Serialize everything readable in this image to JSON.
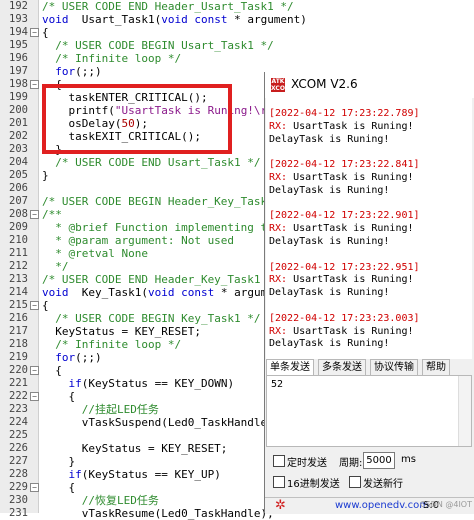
{
  "editor": {
    "lines": [
      {
        "n": "192",
        "fold": "",
        "parts": [
          [
            "cm",
            "/* USER CODE END Header_Usart_Task1 */"
          ]
        ]
      },
      {
        "n": "193",
        "fold": "",
        "parts": [
          [
            "kw",
            "void"
          ],
          [
            "",
            "  Usart_Task1("
          ],
          [
            "kw",
            "void const"
          ],
          [
            "",
            " * argument)"
          ]
        ]
      },
      {
        "n": "194",
        "fold": "box",
        "parts": [
          [
            "",
            "{"
          ]
        ]
      },
      {
        "n": "195",
        "fold": "",
        "parts": [
          [
            "",
            "  "
          ],
          [
            "cm",
            "/* USER CODE BEGIN Usart_Task1 */"
          ]
        ]
      },
      {
        "n": "196",
        "fold": "",
        "parts": [
          [
            "",
            "  "
          ],
          [
            "cm",
            "/* Infinite loop */"
          ]
        ]
      },
      {
        "n": "197",
        "fold": "",
        "parts": [
          [
            "",
            "  "
          ],
          [
            "kw",
            "for"
          ],
          [
            "",
            "(;;)"
          ]
        ]
      },
      {
        "n": "198",
        "fold": "box",
        "parts": [
          [
            "",
            "  {"
          ]
        ]
      },
      {
        "n": "199",
        "fold": "",
        "parts": [
          [
            "",
            "    taskENTER_CRITICAL();"
          ]
        ]
      },
      {
        "n": "200",
        "fold": "",
        "parts": [
          [
            "",
            "    printf("
          ],
          [
            "str",
            "\"UsartTask is Runing!\\r\\"
          ]
        ]
      },
      {
        "n": "201",
        "fold": "",
        "parts": [
          [
            "",
            "    osDelay("
          ],
          [
            "num",
            "50"
          ],
          [
            "",
            ");"
          ]
        ]
      },
      {
        "n": "202",
        "fold": "",
        "parts": [
          [
            "",
            "    taskEXIT_CRITICAL();"
          ]
        ]
      },
      {
        "n": "203",
        "fold": "",
        "parts": [
          [
            "",
            "  }"
          ]
        ]
      },
      {
        "n": "204",
        "fold": "",
        "parts": [
          [
            "",
            "  "
          ],
          [
            "cm",
            "/* USER CODE END Usart_Task1 */"
          ]
        ]
      },
      {
        "n": "205",
        "fold": "",
        "parts": [
          [
            "",
            "}"
          ]
        ]
      },
      {
        "n": "206",
        "fold": "",
        "parts": [
          [
            "",
            ""
          ]
        ]
      },
      {
        "n": "207",
        "fold": "",
        "parts": [
          [
            "cm",
            "/* USER CODE BEGIN Header_Key_Task1 */"
          ]
        ]
      },
      {
        "n": "208",
        "fold": "box",
        "parts": [
          [
            "cm",
            "/**"
          ]
        ]
      },
      {
        "n": "209",
        "fold": "",
        "parts": [
          [
            "cm",
            "  * @brief Function implementing the"
          ]
        ]
      },
      {
        "n": "210",
        "fold": "",
        "parts": [
          [
            "cm",
            "  * @param argument: Not used"
          ]
        ]
      },
      {
        "n": "211",
        "fold": "",
        "parts": [
          [
            "cm",
            "  * @retval None"
          ]
        ]
      },
      {
        "n": "212",
        "fold": "",
        "parts": [
          [
            "cm",
            "  */"
          ]
        ]
      },
      {
        "n": "213",
        "fold": "",
        "parts": [
          [
            "cm",
            "/* USER CODE END Header_Key_Task1 */"
          ]
        ]
      },
      {
        "n": "214",
        "fold": "",
        "parts": [
          [
            "kw",
            "void"
          ],
          [
            "",
            "  Key_Task1("
          ],
          [
            "kw",
            "void const"
          ],
          [
            "",
            " * argumen"
          ]
        ]
      },
      {
        "n": "215",
        "fold": "box",
        "parts": [
          [
            "",
            "{"
          ]
        ]
      },
      {
        "n": "216",
        "fold": "",
        "parts": [
          [
            "",
            "  "
          ],
          [
            "cm",
            "/* USER CODE BEGIN Key_Task1 */"
          ]
        ]
      },
      {
        "n": "217",
        "fold": "",
        "parts": [
          [
            "",
            "  KeyStatus = KEY_RESET;"
          ]
        ]
      },
      {
        "n": "218",
        "fold": "",
        "parts": [
          [
            "",
            "  "
          ],
          [
            "cm",
            "/* Infinite loop */"
          ]
        ]
      },
      {
        "n": "219",
        "fold": "",
        "parts": [
          [
            "",
            "  "
          ],
          [
            "kw",
            "for"
          ],
          [
            "",
            "(;;)"
          ]
        ]
      },
      {
        "n": "220",
        "fold": "box",
        "parts": [
          [
            "",
            "  {"
          ]
        ]
      },
      {
        "n": "221",
        "fold": "",
        "parts": [
          [
            "",
            "    "
          ],
          [
            "kw",
            "if"
          ],
          [
            "",
            "(KeyStatus == KEY_DOWN)"
          ]
        ]
      },
      {
        "n": "222",
        "fold": "box",
        "parts": [
          [
            "",
            "    {"
          ]
        ]
      },
      {
        "n": "223",
        "fold": "",
        "parts": [
          [
            "",
            "      "
          ],
          [
            "cm",
            "//挂起LED任务"
          ]
        ]
      },
      {
        "n": "224",
        "fold": "",
        "parts": [
          [
            "",
            "      vTaskSuspend(Led0_TaskHandle)"
          ]
        ]
      },
      {
        "n": "225",
        "fold": "",
        "parts": [
          [
            "",
            ""
          ]
        ]
      },
      {
        "n": "226",
        "fold": "",
        "parts": [
          [
            "",
            "      KeyStatus = KEY_RESET;"
          ]
        ]
      },
      {
        "n": "227",
        "fold": "",
        "parts": [
          [
            "",
            "    }"
          ]
        ]
      },
      {
        "n": "228",
        "fold": "",
        "parts": [
          [
            "",
            "    "
          ],
          [
            "kw",
            "if"
          ],
          [
            "",
            "(KeyStatus == KEY_UP)"
          ]
        ]
      },
      {
        "n": "229",
        "fold": "box",
        "parts": [
          [
            "",
            "    {"
          ]
        ]
      },
      {
        "n": "230",
        "fold": "",
        "parts": [
          [
            "",
            "      "
          ],
          [
            "cm",
            "//恢复LED任务"
          ]
        ]
      },
      {
        "n": "231",
        "fold": "",
        "parts": [
          [
            "",
            "      vTaskResume(Led0_TaskHandle);"
          ]
        ]
      }
    ]
  },
  "xcom": {
    "logo": "ATK XCOM",
    "title": "XCOM V2.6",
    "receive": [
      {
        "kind": "ts",
        "text": "[2022-04-12 17:23:22.789]"
      },
      {
        "kind": "rx",
        "tag": "RX:",
        "text": "UsartTask is Runing!"
      },
      {
        "kind": "txt",
        "text": "DelayTask is Runing!"
      },
      {
        "kind": "blank",
        "text": ""
      },
      {
        "kind": "ts",
        "text": "[2022-04-12 17:23:22.841]"
      },
      {
        "kind": "rx",
        "tag": "RX:",
        "text": "UsartTask is Runing!"
      },
      {
        "kind": "txt",
        "text": "DelayTask is Runing!"
      },
      {
        "kind": "blank",
        "text": ""
      },
      {
        "kind": "ts",
        "text": "[2022-04-12 17:23:22.901]"
      },
      {
        "kind": "rx",
        "tag": "RX:",
        "text": "UsartTask is Runing!"
      },
      {
        "kind": "txt",
        "text": "DelayTask is Runing!"
      },
      {
        "kind": "blank",
        "text": ""
      },
      {
        "kind": "ts",
        "text": "[2022-04-12 17:23:22.951]"
      },
      {
        "kind": "rx",
        "tag": "RX:",
        "text": "UsartTask is Runing!"
      },
      {
        "kind": "txt",
        "text": "DelayTask is Runing!"
      },
      {
        "kind": "blank",
        "text": ""
      },
      {
        "kind": "ts",
        "text": "[2022-04-12 17:23:23.003]"
      },
      {
        "kind": "rx",
        "tag": "RX:",
        "text": "UsartTask is Runing!"
      },
      {
        "kind": "txt",
        "text": "DelayTask is Runing!"
      }
    ],
    "tabs": [
      "单条发送",
      "多条发送",
      "协议传输",
      "帮助"
    ],
    "send_text": "52",
    "timed_send_label": "定时发送",
    "period_label": "周期:",
    "period_value": "5000",
    "period_unit": "ms",
    "hex_send_label": "16进制发送",
    "newline_label": "发送新行",
    "url": "www.openedv.com",
    "status_s": "S:0"
  },
  "watermark": "CSDN @4IOT",
  "colors": {
    "highlight_box": "#e02020",
    "timestamp": "#d00000",
    "comment": "#2e8b2e",
    "keyword": "#0000d0"
  }
}
